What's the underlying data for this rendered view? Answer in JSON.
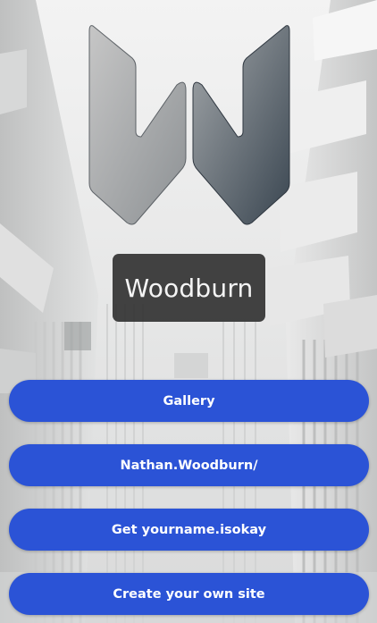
{
  "site": {
    "title": "Woodburn",
    "logo_icon": "w-logo-icon",
    "background_icon": "architecture-background"
  },
  "links": [
    {
      "label": "Gallery"
    },
    {
      "label": "Nathan.Woodburn/"
    },
    {
      "label": "Get yourname.isokay"
    },
    {
      "label": "Create your own site"
    }
  ],
  "colors": {
    "button": "#2b53d6",
    "button_text": "#ffffff",
    "title_box": "#343434",
    "title_text": "#f4f4f4"
  }
}
